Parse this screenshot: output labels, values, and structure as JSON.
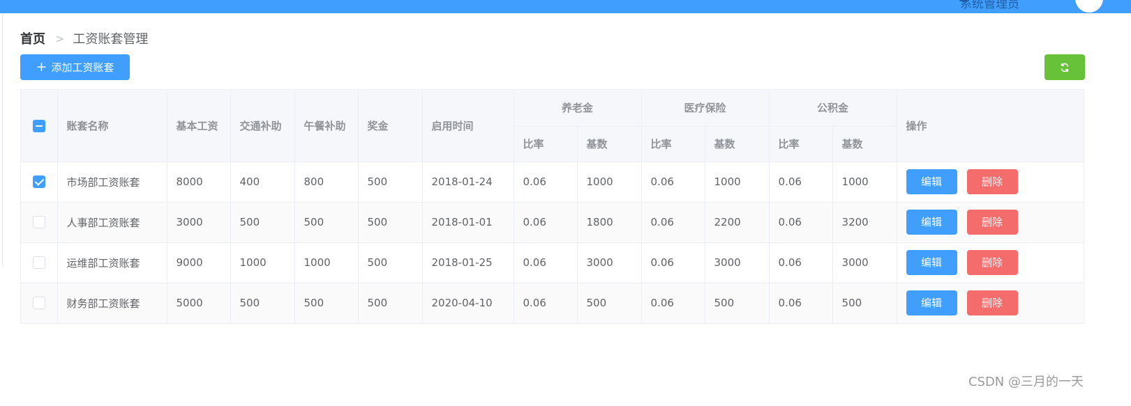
{
  "topbar": {
    "user_label": "系统管理员",
    "accent_color": "#409eff"
  },
  "breadcrumb": {
    "home": "首页",
    "separator": ">",
    "current": "工资账套管理"
  },
  "toolbar": {
    "add_icon": "plus-icon",
    "add_label": "添加工资账套",
    "refresh_icon": "refresh-icon"
  },
  "table": {
    "headers": {
      "name": "账套名称",
      "base_salary": "基本工资",
      "traffic": "交通补助",
      "lunch": "午餐补助",
      "bonus": "奖金",
      "start_date": "启用时间",
      "pension": "养老金",
      "medical": "医疗保险",
      "housing_fund": "公积金",
      "rate": "比率",
      "base": "基数",
      "actions": "操作"
    },
    "header_checkbox_state": "indeterminate",
    "rows": [
      {
        "checked": true,
        "name": "市场部工资账套",
        "base_salary": "8000",
        "traffic": "400",
        "lunch": "800",
        "bonus": "500",
        "start_date": "2018-01-24",
        "pension_rate": "0.06",
        "pension_base": "1000",
        "medical_rate": "0.06",
        "medical_base": "1000",
        "fund_rate": "0.06",
        "fund_base": "1000"
      },
      {
        "checked": false,
        "name": "人事部工资账套",
        "base_salary": "3000",
        "traffic": "500",
        "lunch": "500",
        "bonus": "500",
        "start_date": "2018-01-01",
        "pension_rate": "0.06",
        "pension_base": "1800",
        "medical_rate": "0.06",
        "medical_base": "2200",
        "fund_rate": "0.06",
        "fund_base": "3200"
      },
      {
        "checked": false,
        "name": "运维部工资账套",
        "base_salary": "9000",
        "traffic": "1000",
        "lunch": "1000",
        "bonus": "500",
        "start_date": "2018-01-25",
        "pension_rate": "0.06",
        "pension_base": "3000",
        "medical_rate": "0.06",
        "medical_base": "3000",
        "fund_rate": "0.06",
        "fund_base": "3000"
      },
      {
        "checked": false,
        "name": "财务部工资账套",
        "base_salary": "5000",
        "traffic": "500",
        "lunch": "500",
        "bonus": "500",
        "start_date": "2020-04-10",
        "pension_rate": "0.06",
        "pension_base": "500",
        "medical_rate": "0.06",
        "medical_base": "500",
        "fund_rate": "0.06",
        "fund_base": "500"
      }
    ],
    "edit_label": "编辑",
    "delete_label": "删除"
  },
  "watermark": "CSDN @三月的一天",
  "colors": {
    "primary": "#409eff",
    "success": "#67c23a",
    "danger": "#f56c6c"
  }
}
